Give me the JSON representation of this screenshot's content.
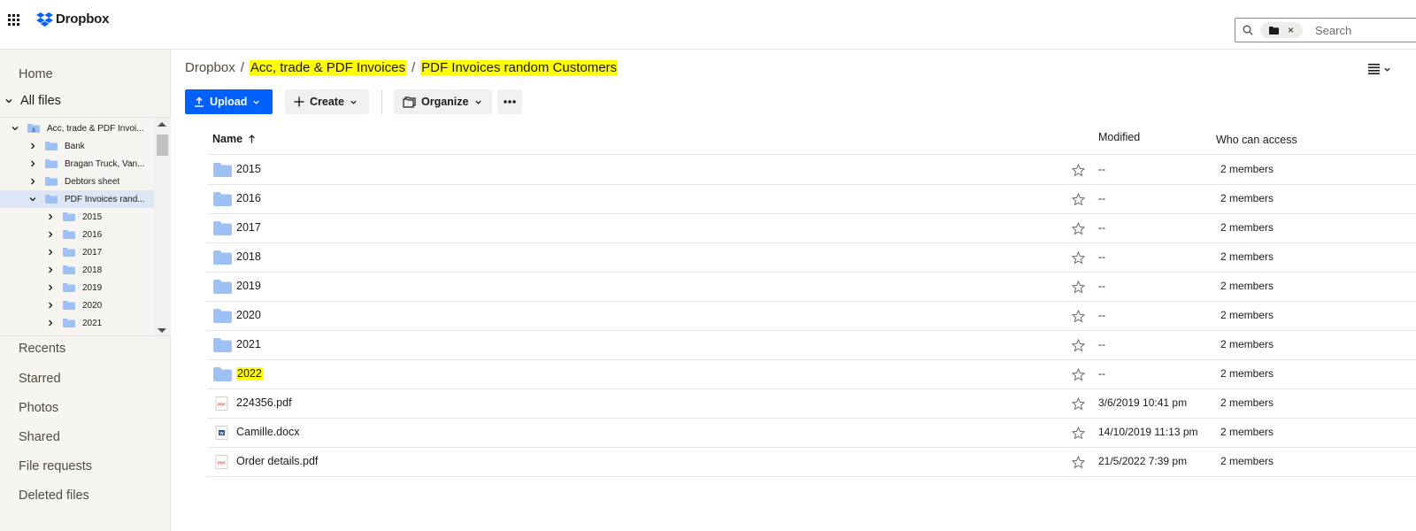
{
  "app": {
    "name": "Dropbox"
  },
  "search": {
    "placeholder": "Search",
    "scope_icon": "folder-icon",
    "clear": "×"
  },
  "sidebar": {
    "home": "Home",
    "all_files": "All files",
    "tree": [
      {
        "label": "Acc, trade & PDF Invoi...",
        "level": 0,
        "icon": "shared-folder-icon",
        "expanded": true,
        "selected": false
      },
      {
        "label": "Bank",
        "level": 1,
        "icon": "folder-icon",
        "expanded": false,
        "selected": false
      },
      {
        "label": "Bragan Truck, Van...",
        "level": 1,
        "icon": "folder-icon",
        "expanded": false,
        "selected": false
      },
      {
        "label": "Debtors sheet",
        "level": 1,
        "icon": "folder-icon",
        "expanded": false,
        "selected": false
      },
      {
        "label": "PDF Invoices rand...",
        "level": 1,
        "icon": "folder-icon",
        "expanded": true,
        "selected": true
      },
      {
        "label": "2015",
        "level": 2,
        "icon": "folder-icon",
        "expanded": false,
        "selected": false
      },
      {
        "label": "2016",
        "level": 2,
        "icon": "folder-icon",
        "expanded": false,
        "selected": false
      },
      {
        "label": "2017",
        "level": 2,
        "icon": "folder-icon",
        "expanded": false,
        "selected": false
      },
      {
        "label": "2018",
        "level": 2,
        "icon": "folder-icon",
        "expanded": false,
        "selected": false
      },
      {
        "label": "2019",
        "level": 2,
        "icon": "folder-icon",
        "expanded": false,
        "selected": false
      },
      {
        "label": "2020",
        "level": 2,
        "icon": "folder-icon",
        "expanded": false,
        "selected": false
      },
      {
        "label": "2021",
        "level": 2,
        "icon": "folder-icon",
        "expanded": false,
        "selected": false
      }
    ],
    "bottom_nav": [
      "Recents",
      "Starred",
      "Photos",
      "Shared",
      "File requests",
      "Deleted files"
    ]
  },
  "breadcrumb": {
    "root": "Dropbox",
    "separator": "/",
    "parent": "Acc, trade & PDF Invoices",
    "current": "PDF Invoices random Customers"
  },
  "toolbar": {
    "upload": "Upload",
    "create": "Create",
    "organize": "Organize",
    "more": "•••"
  },
  "table": {
    "columns": {
      "name": "Name",
      "modified": "Modified",
      "access": "Who can access"
    },
    "rows": [
      {
        "name": "2015",
        "type": "folder",
        "modified": "--",
        "access": "2 members",
        "highlight": false
      },
      {
        "name": "2016",
        "type": "folder",
        "modified": "--",
        "access": "2 members",
        "highlight": false
      },
      {
        "name": "2017",
        "type": "folder",
        "modified": "--",
        "access": "2 members",
        "highlight": false
      },
      {
        "name": "2018",
        "type": "folder",
        "modified": "--",
        "access": "2 members",
        "highlight": false
      },
      {
        "name": "2019",
        "type": "folder",
        "modified": "--",
        "access": "2 members",
        "highlight": false
      },
      {
        "name": "2020",
        "type": "folder",
        "modified": "--",
        "access": "2 members",
        "highlight": false
      },
      {
        "name": "2021",
        "type": "folder",
        "modified": "--",
        "access": "2 members",
        "highlight": false
      },
      {
        "name": "2022",
        "type": "folder",
        "modified": "--",
        "access": "2 members",
        "highlight": true
      },
      {
        "name": "224356.pdf",
        "type": "pdf",
        "modified": "3/6/2019 10:41 pm",
        "access": "2 members",
        "highlight": false
      },
      {
        "name": "Camille.docx",
        "type": "docx",
        "modified": "14/10/2019 11:13 pm",
        "access": "2 members",
        "highlight": false
      },
      {
        "name": "Order details.pdf",
        "type": "pdf",
        "modified": "21/5/2022 7:39 pm",
        "access": "2 members",
        "highlight": false
      }
    ]
  },
  "colors": {
    "accent": "#0061fe",
    "folder": "#9ec1f5",
    "highlight": "#ffff00",
    "sidebar_bg": "#f7f5f2",
    "selected_bg": "#dde6f5"
  }
}
